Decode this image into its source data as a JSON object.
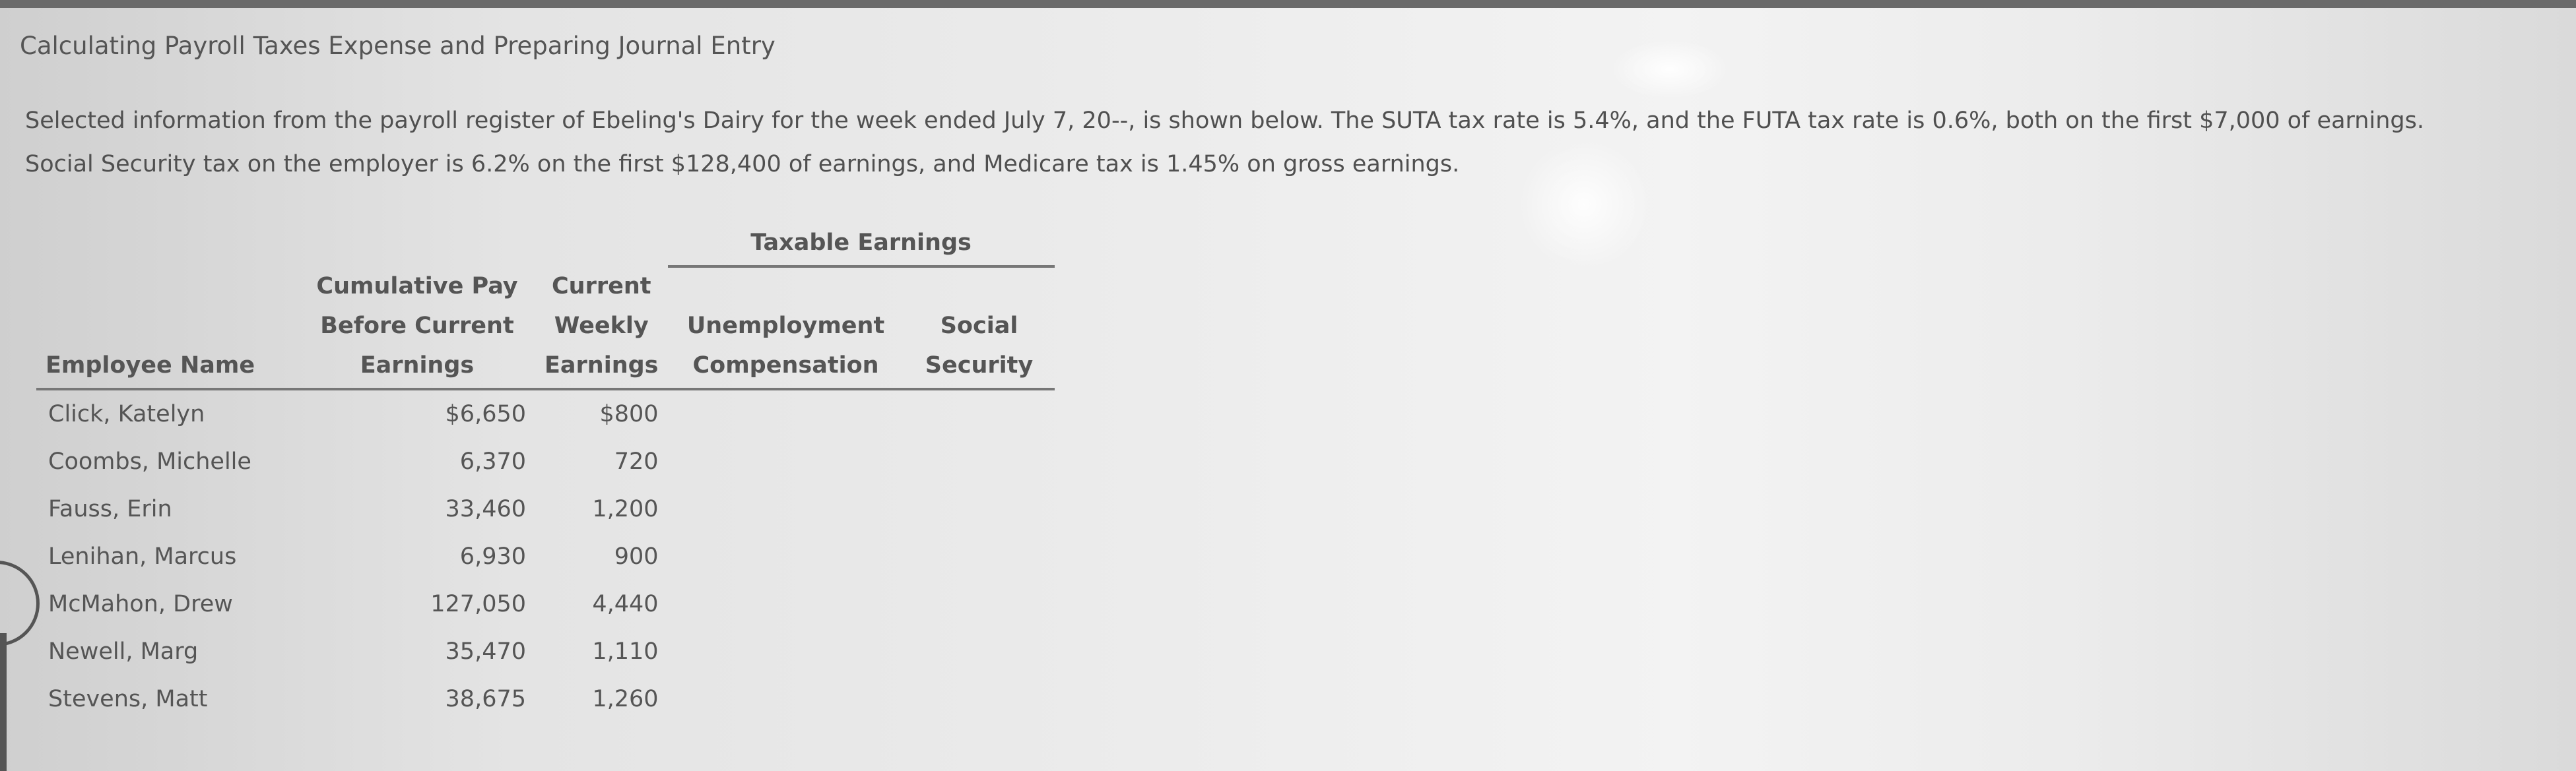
{
  "page": {
    "title": "Calculating Payroll Taxes Expense and Preparing Journal Entry",
    "intro_line_1": "Selected information from the payroll register of Ebeling's Dairy for the week ended July 7, 20--, is shown below. The SUTA tax rate is 5.4%, and the FUTA tax rate is 0.6%, both on the first $7,000 of earnings.",
    "intro_line_2": "Social Security tax on the employer is 6.2% on the first $128,400 of earnings, and Medicare tax is 1.45% on gross earnings."
  },
  "table": {
    "group_header": "Taxable Earnings",
    "headers": {
      "employee_name": "Employee Name",
      "cumulative_line1": "Cumulative Pay",
      "cumulative_line2": "Before Current",
      "cumulative_line3": "Earnings",
      "current_line1": "Current",
      "current_line2": "Weekly",
      "current_line3": "Earnings",
      "unemployment_line1": "Unemployment",
      "unemployment_line2": "Compensation",
      "social_line1": "Social",
      "social_line2": "Security"
    },
    "rows": [
      {
        "name": "Click, Katelyn",
        "cumulative": "$6,650",
        "current": "$800",
        "unemployment": "",
        "social_security": ""
      },
      {
        "name": "Coombs, Michelle",
        "cumulative": "6,370",
        "current": "720",
        "unemployment": "",
        "social_security": ""
      },
      {
        "name": "Fauss, Erin",
        "cumulative": "33,460",
        "current": "1,200",
        "unemployment": "",
        "social_security": ""
      },
      {
        "name": "Lenihan, Marcus",
        "cumulative": "6,930",
        "current": "900",
        "unemployment": "",
        "social_security": ""
      },
      {
        "name": "McMahon, Drew",
        "cumulative": "127,050",
        "current": "4,440",
        "unemployment": "",
        "social_security": ""
      },
      {
        "name": "Newell, Marg",
        "cumulative": "35,470",
        "current": "1,110",
        "unemployment": "",
        "social_security": ""
      },
      {
        "name": "Stevens, Matt",
        "cumulative": "38,675",
        "current": "1,260",
        "unemployment": "",
        "social_security": ""
      }
    ]
  }
}
